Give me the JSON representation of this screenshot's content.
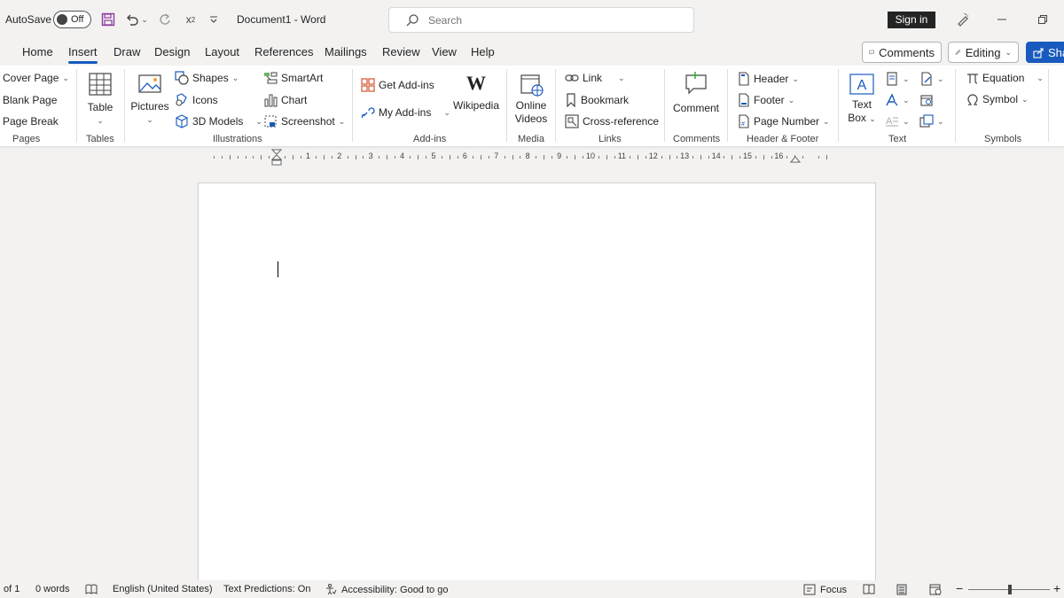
{
  "titlebar": {
    "autosave_label": "AutoSave",
    "autosave_state": "Off",
    "subscript_label": "x",
    "document_title": "Document1  -  Word",
    "search_placeholder": "Search",
    "signin_label": "Sign in"
  },
  "menu": {
    "tabs": [
      "Home",
      "Insert",
      "Draw",
      "Design",
      "Layout",
      "References",
      "Mailings",
      "Review",
      "View",
      "Help"
    ],
    "active_tab": "Insert",
    "comments_label": "Comments",
    "editing_label": "Editing",
    "share_label": "Sha"
  },
  "ribbon": {
    "pages": {
      "group": "Pages",
      "items": [
        "Cover Page",
        "Blank Page",
        "Page Break"
      ]
    },
    "tables": {
      "group": "Tables",
      "table_label": "Table"
    },
    "illustrations": {
      "group": "Illustrations",
      "pictures_label": "Pictures",
      "shapes": "Shapes",
      "icons": "Icons",
      "models": "3D Models",
      "smartart": "SmartArt",
      "chart": "Chart",
      "screenshot": "Screenshot"
    },
    "addins": {
      "group": "Add-ins",
      "get": "Get Add-ins",
      "my": "My Add-ins",
      "wikipedia": "Wikipedia"
    },
    "media": {
      "group": "Media",
      "online_videos_1": "Online",
      "online_videos_2": "Videos"
    },
    "links": {
      "group": "Links",
      "link": "Link",
      "bookmark": "Bookmark",
      "crossref": "Cross-reference"
    },
    "comments": {
      "group": "Comments",
      "comment": "Comment"
    },
    "header_footer": {
      "group": "Header & Footer",
      "header": "Header",
      "footer": "Footer",
      "page_number": "Page Number"
    },
    "text": {
      "group": "Text",
      "textbox_1": "Text",
      "textbox_2": "Box"
    },
    "symbols": {
      "group": "Symbols",
      "equation": "Equation",
      "symbol": "Symbol"
    }
  },
  "ruler": {
    "numbers": [
      "1",
      "2",
      "3",
      "4",
      "5",
      "6",
      "7",
      "8",
      "9",
      "10",
      "11",
      "12",
      "13",
      "14",
      "15",
      "16"
    ]
  },
  "status": {
    "page": "of 1",
    "words": "0 words",
    "language": "English (United States)",
    "predictions": "Text Predictions: On",
    "accessibility": "Accessibility: Good to go",
    "focus": "Focus"
  },
  "colors": {
    "accent": "#185abd",
    "background": "#f3f2f1",
    "ribbon": "#ffffff"
  }
}
